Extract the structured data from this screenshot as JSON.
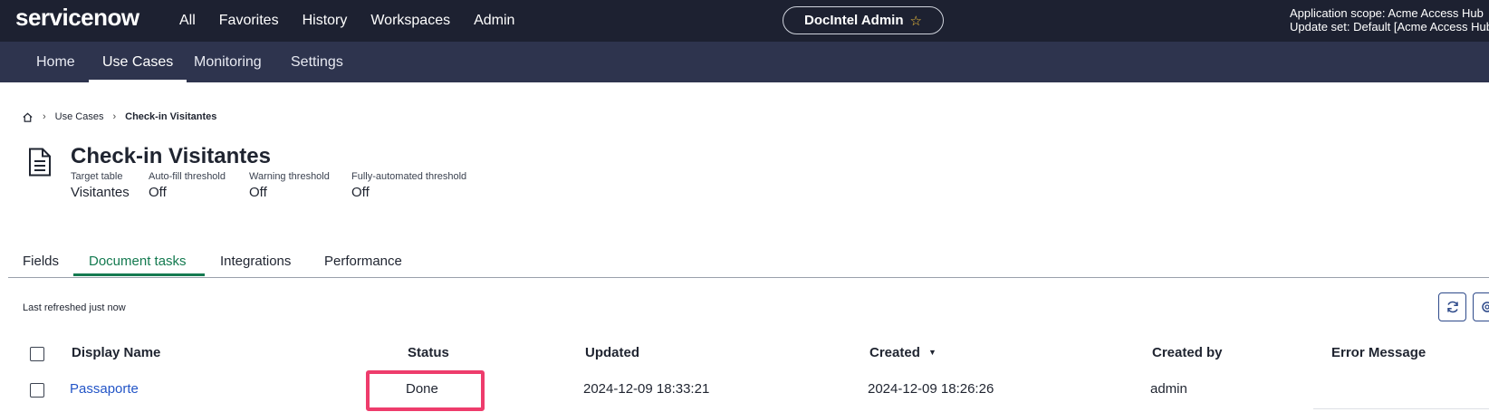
{
  "topbar": {
    "logo": "servicenow",
    "nav": [
      "All",
      "Favorites",
      "History",
      "Workspaces",
      "Admin"
    ],
    "workspace_pill": "DocIntel Admin",
    "scope_line1": "Application scope: Acme Access Hub",
    "scope_line2": "Update set: Default [Acme Access Hub"
  },
  "subnav": {
    "tabs": [
      "Home",
      "Use Cases",
      "Monitoring",
      "Settings"
    ],
    "active": "Use Cases"
  },
  "breadcrumb": {
    "items": [
      "Use Cases",
      "Check-in Visitantes"
    ]
  },
  "usecase": {
    "title": "Check-in Visitantes",
    "meta": [
      {
        "label": "Target table",
        "value": "Visitantes"
      },
      {
        "label": "Auto-fill threshold",
        "value": "Off"
      },
      {
        "label": "Warning threshold",
        "value": "Off"
      },
      {
        "label": "Fully-automated threshold",
        "value": "Off"
      }
    ]
  },
  "tabs": {
    "items": [
      "Fields",
      "Document tasks",
      "Integrations",
      "Performance"
    ],
    "active": "Document tasks"
  },
  "list": {
    "refreshed": "Last refreshed just now",
    "columns": [
      "Display Name",
      "Status",
      "Updated",
      "Created",
      "Created by",
      "Error Message"
    ],
    "sort_column": "Created",
    "rows": [
      {
        "display_name": "Passaporte",
        "status": "Done",
        "updated": "2024-12-09 18:33:21",
        "created": "2024-12-09 18:26:26",
        "created_by": "admin",
        "error": ""
      }
    ]
  },
  "colors": {
    "topbar_bg": "#1d2131",
    "subnav_bg": "#2e344e",
    "accent_green": "#147a50",
    "link_blue": "#2355c7",
    "highlight_pink": "#ee3c6c"
  },
  "icons": [
    "home-icon",
    "chevron-right-icon",
    "document-icon",
    "star-icon",
    "refresh-icon",
    "gear-icon",
    "sort-desc-icon"
  ]
}
